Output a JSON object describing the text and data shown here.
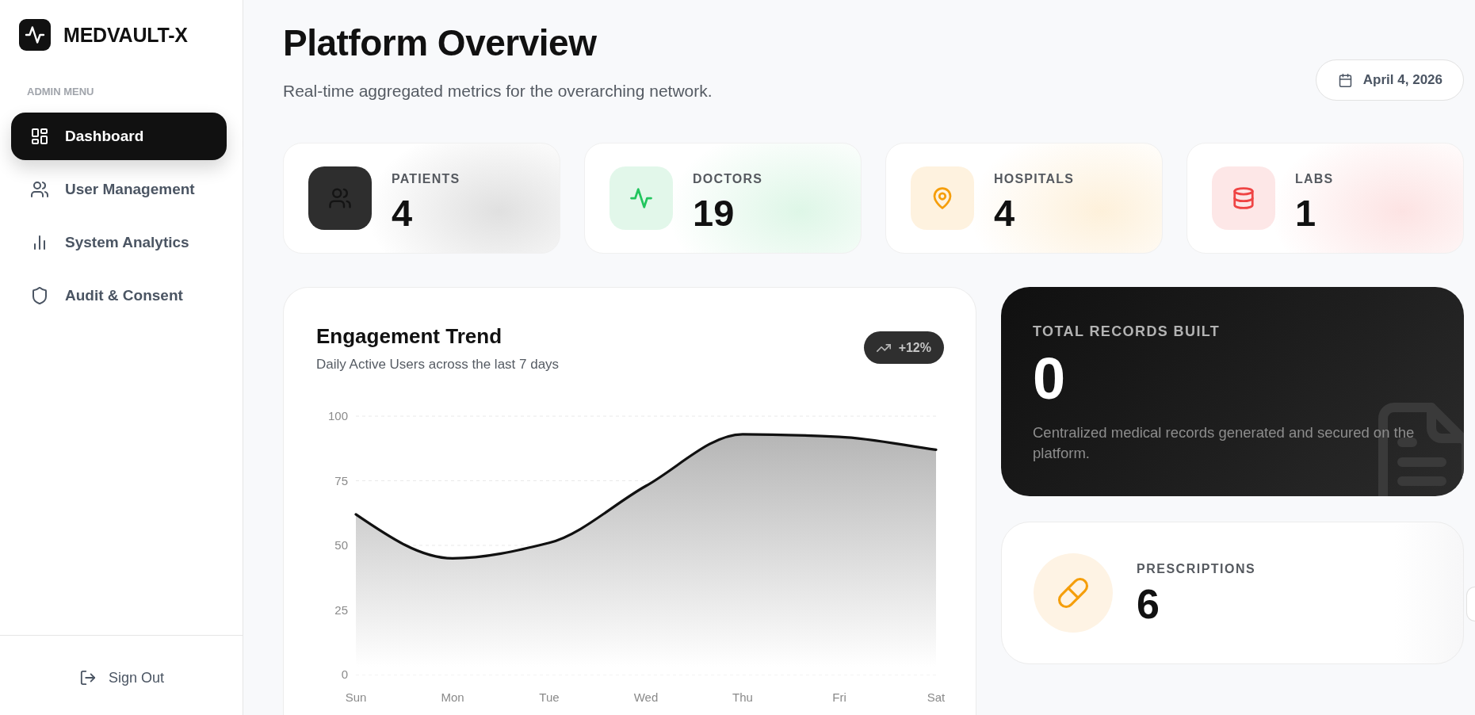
{
  "sidebar": {
    "brand": "MEDVAULT-X",
    "section_label": "ADMIN MENU",
    "items": [
      {
        "label": "Dashboard",
        "selected": true
      },
      {
        "label": "User Management",
        "selected": false
      },
      {
        "label": "System Analytics",
        "selected": false
      },
      {
        "label": "Audit & Consent",
        "selected": false
      }
    ],
    "sign_out": "Sign Out"
  },
  "header": {
    "title": "Platform Overview",
    "subtitle": "Real-time aggregated metrics for the overarching network.",
    "date": "April 4, 2026"
  },
  "stats": [
    {
      "label": "PATIENTS",
      "value": "4",
      "kind": "solid",
      "color": "#2e2e2e"
    },
    {
      "label": "DOCTORS",
      "value": "19",
      "kind": "soft",
      "color": "#22c55e"
    },
    {
      "label": "HOSPITALS",
      "value": "4",
      "kind": "soft",
      "color": "#f59e0b"
    },
    {
      "label": "LABS",
      "value": "1",
      "kind": "soft",
      "color": "#ef4444"
    }
  ],
  "engagement": {
    "title": "Engagement Trend",
    "subtitle": "Daily Active Users across the last 7 days",
    "badge": "+12%",
    "chart_data": {
      "type": "area",
      "categories": [
        "Sun",
        "Mon",
        "Tue",
        "Wed",
        "Thu",
        "Fri",
        "Sat"
      ],
      "values": [
        62,
        45,
        51,
        73,
        93,
        92,
        87
      ],
      "ylim": [
        0,
        100
      ],
      "yticks": [
        0,
        25,
        50,
        75,
        100
      ]
    }
  },
  "total_records": {
    "label": "TOTAL RECORDS BUILT",
    "value": "0",
    "description": "Centralized medical records generated and secured on the platform."
  },
  "prescriptions": {
    "label": "PRESCRIPTIONS",
    "value": "6"
  }
}
